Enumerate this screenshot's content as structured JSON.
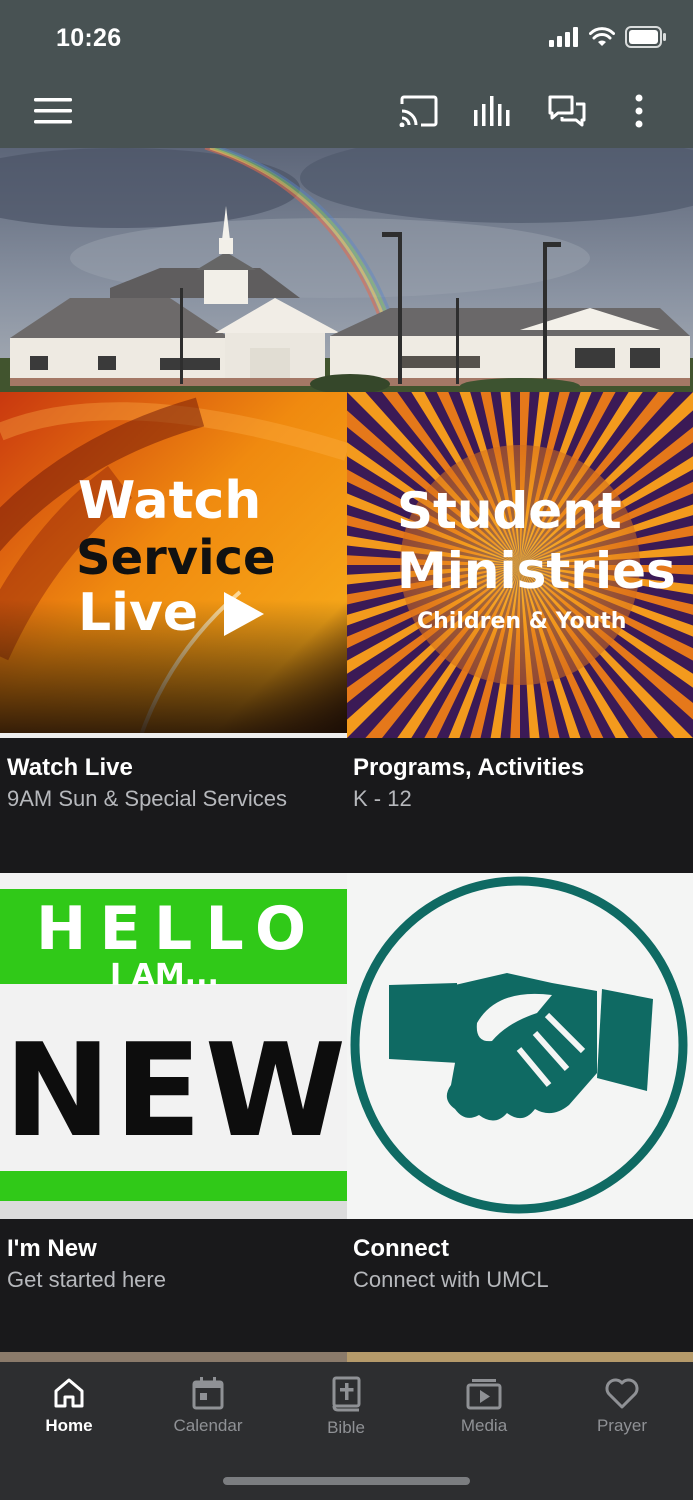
{
  "status_bar": {
    "time": "10:26",
    "icons": [
      "signal-icon",
      "wifi-icon",
      "battery-icon"
    ]
  },
  "app_bar": {
    "icons": [
      "menu-icon",
      "cast-icon",
      "audio-icon",
      "chat-icon",
      "more-icon"
    ]
  },
  "tiles": [
    {
      "image_lines": [
        "Watch",
        "Service",
        "Live"
      ],
      "title": "Watch Live",
      "subtitle": "9AM Sun & Special Services"
    },
    {
      "image_lines": [
        "Student",
        "Ministries",
        "Children & Youth"
      ],
      "title": "Programs, Activities",
      "subtitle": "K - 12"
    },
    {
      "image_lines": [
        "HELLO",
        "I AM...",
        "NEW"
      ],
      "title": "I'm New",
      "subtitle": "Get started here"
    },
    {
      "title": "Connect",
      "subtitle": "Connect with UMCL"
    }
  ],
  "tab_bar": {
    "active": "Home",
    "items": [
      {
        "label": "Home",
        "icon": "home-icon"
      },
      {
        "label": "Calendar",
        "icon": "calendar-icon"
      },
      {
        "label": "Bible",
        "icon": "bible-icon"
      },
      {
        "label": "Media",
        "icon": "media-icon"
      },
      {
        "label": "Prayer",
        "icon": "heart-icon"
      }
    ]
  },
  "colors": {
    "header": "#485253",
    "background": "#19191b",
    "tab_bar": "#2d2e30",
    "accent_teal": "#0f6a63",
    "new_green": "#2fcf17"
  }
}
